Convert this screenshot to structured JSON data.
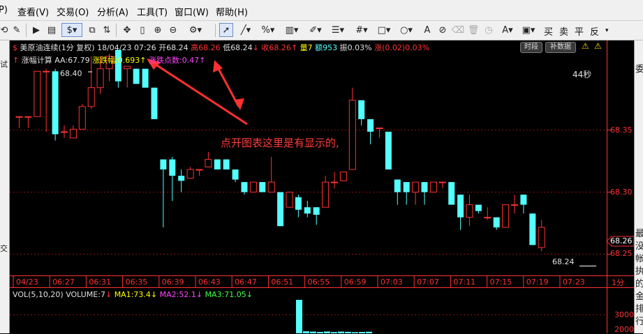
{
  "menu": {
    "items": [
      "P)",
      "查看(V)",
      "交易(O)",
      "分析(A)",
      "工具(T)",
      "窗口(W)",
      "帮助(H)"
    ]
  },
  "toolbar": {
    "text_buttons": [
      "买",
      "卖",
      "平",
      "反"
    ],
    "icons": [
      "rotate-icon",
      "edit-icon",
      "play-icon",
      "note-icon",
      "dollar-icon",
      "copy-icon",
      "sync-icon",
      "move-icon",
      "ruler-icon",
      "zoom-in-icon",
      "zoom-out-icon",
      "settings-icon",
      "cursor-icon",
      "line-icon",
      "percent-icon",
      "ruler-bar-icon",
      "pen-icon",
      "bars-icon",
      "grid-icon",
      "rect-icon",
      "circle-icon",
      "text-icon",
      "clear-icon",
      "trash-icon",
      "color-a-icon",
      "image-icon",
      "save-icon"
    ]
  },
  "left_strip": {
    "labels": [
      "试",
      "交"
    ]
  },
  "right_strip": {
    "labels": [
      "委",
      "最",
      "没",
      "帐",
      "执",
      "的",
      "金",
      "排",
      "行"
    ]
  },
  "header": {
    "symbol": "美原油连续(1分 复权)",
    "datetime": "18/04/23 07:26",
    "open_label": "开",
    "open": "68.24",
    "high_label": "高",
    "high": "68.26",
    "low_label": "低",
    "low": "68.24",
    "close_label": "收",
    "close": "68.26",
    "volume_label": "量",
    "volume": "7",
    "amount_label": "额",
    "amount": "953",
    "amplitude_label": "振",
    "amplitude": "0.03%",
    "change_label": "涨",
    "change": "(0.02)",
    "change_pct": "0.03%",
    "btn_time": "时段",
    "btn_fill": "补数据"
  },
  "indicator": {
    "name": "涨幅计算",
    "aa": "AA:67.79",
    "amp_label": "涨跌幅:",
    "amp_value": "0.693",
    "pts_label": "涨跌点数:",
    "pts_value": "0.47"
  },
  "countdown": "44秒",
  "high_marker": "68.40",
  "low_marker": "68.24",
  "annotation": "点开图表这里是有显示的,",
  "price_axis": {
    "ticks": [
      "68.35",
      "68.30",
      "68.25"
    ],
    "current": "68.26"
  },
  "time_axis": {
    "labels": [
      "04/23",
      "06:27",
      "06:31",
      "06:35",
      "06:39",
      "06:43",
      "06:47",
      "06:51",
      "06:55",
      "06:59",
      "07:03",
      "07:07",
      "07:11",
      "07:15",
      "07:19",
      "07:23"
    ],
    "period": "1分"
  },
  "volume_panel": {
    "title": "VOL(5,10,20)",
    "volume": "VOLUME:7",
    "ma1": "MA1:73.4",
    "ma2": "MA2:52.1",
    "ma3": "MA3:71.05",
    "ticks": [
      "3000",
      "2000"
    ]
  },
  "colors": {
    "up": "#ff3232",
    "down": "#54ffff",
    "ma1": "#ffff00",
    "ma2": "#ff00ff",
    "ma3": "#00ff00",
    "annotation": "#ff3c3c",
    "axis": "#ff3232"
  },
  "chart_data": {
    "type": "candlestick",
    "y_range": [
      68.2275,
      68.4125
    ],
    "candles": [
      {
        "o": 68.352,
        "h": 68.352,
        "l": 68.343,
        "c": 68.352
      },
      {
        "o": 68.352,
        "h": 68.352,
        "l": 68.343,
        "c": 68.352
      },
      {
        "o": 68.352,
        "h": 68.388,
        "l": 68.352,
        "c": 68.388
      },
      {
        "o": 68.388,
        "h": 68.39,
        "l": 68.34,
        "c": 68.388
      },
      {
        "o": 68.388,
        "h": 68.39,
        "l": 68.333,
        "c": 68.338
      },
      {
        "o": 68.34,
        "h": 68.345,
        "l": 68.335,
        "c": 68.34
      },
      {
        "o": 68.335,
        "h": 68.345,
        "l": 68.335,
        "c": 68.342
      },
      {
        "o": 68.342,
        "h": 68.362,
        "l": 68.342,
        "c": 68.36
      },
      {
        "o": 68.36,
        "h": 68.4,
        "l": 68.358,
        "c": 68.375
      },
      {
        "o": 68.375,
        "h": 68.4,
        "l": 68.37,
        "c": 68.39
      },
      {
        "o": 68.39,
        "h": 68.402,
        "l": 68.38,
        "c": 68.4
      },
      {
        "o": 68.405,
        "h": 68.405,
        "l": 68.375,
        "c": 68.38
      },
      {
        "o": 68.39,
        "h": 68.392,
        "l": 68.375,
        "c": 68.392
      },
      {
        "o": 68.39,
        "h": 68.39,
        "l": 68.378,
        "c": 68.378
      },
      {
        "o": 68.39,
        "h": 68.39,
        "l": 68.375,
        "c": 68.375
      },
      {
        "o": 68.375,
        "h": 68.375,
        "l": 68.35,
        "c": 68.35
      },
      {
        "o": 68.318,
        "h": 68.318,
        "l": 68.264,
        "c": 68.31
      },
      {
        "o": 68.318,
        "h": 68.32,
        "l": 68.285,
        "c": 68.305
      },
      {
        "o": 68.305,
        "h": 68.31,
        "l": 68.292,
        "c": 68.301
      },
      {
        "o": 68.303,
        "h": 68.312,
        "l": 68.303,
        "c": 68.31
      },
      {
        "o": 68.31,
        "h": 68.31,
        "l": 68.305,
        "c": 68.31
      },
      {
        "o": 68.312,
        "h": 68.324,
        "l": 68.312,
        "c": 68.318
      },
      {
        "o": 68.318,
        "h": 68.318,
        "l": 68.31,
        "c": 68.31
      },
      {
        "o": 68.318,
        "h": 68.318,
        "l": 68.31,
        "c": 68.31
      },
      {
        "o": 68.31,
        "h": 68.31,
        "l": 68.3,
        "c": 68.302
      },
      {
        "o": 68.3,
        "h": 68.3,
        "l": 68.29,
        "c": 68.292
      },
      {
        "o": 68.292,
        "h": 68.3,
        "l": 68.292,
        "c": 68.3
      },
      {
        "o": 68.3,
        "h": 68.3,
        "l": 68.292,
        "c": 68.292
      },
      {
        "o": 68.292,
        "h": 68.32,
        "l": 68.292,
        "c": 68.3
      },
      {
        "o": 68.292,
        "h": 68.292,
        "l": 68.265,
        "c": 68.265
      },
      {
        "o": 68.28,
        "h": 68.292,
        "l": 68.28,
        "c": 68.292
      },
      {
        "o": 68.288,
        "h": 68.29,
        "l": 68.272,
        "c": 68.278
      },
      {
        "o": 68.28,
        "h": 68.285,
        "l": 68.272,
        "c": 68.275
      },
      {
        "o": 68.28,
        "h": 68.28,
        "l": 68.266,
        "c": 68.274
      },
      {
        "o": 68.28,
        "h": 68.305,
        "l": 68.28,
        "c": 68.3
      },
      {
        "o": 68.3,
        "h": 68.308,
        "l": 68.295,
        "c": 68.3
      },
      {
        "o": 68.301,
        "h": 68.308,
        "l": 68.301,
        "c": 68.308
      },
      {
        "o": 68.31,
        "h": 68.375,
        "l": 68.31,
        "c": 68.365
      },
      {
        "o": 68.365,
        "h": 68.365,
        "l": 68.345,
        "c": 68.35
      },
      {
        "o": 68.35,
        "h": 68.35,
        "l": 68.33,
        "c": 68.34
      },
      {
        "o": 68.343,
        "h": 68.343,
        "l": 68.335,
        "c": 68.343
      },
      {
        "o": 68.34,
        "h": 68.34,
        "l": 68.31,
        "c": 68.31
      },
      {
        "o": 68.302,
        "h": 68.302,
        "l": 68.282,
        "c": 68.292
      },
      {
        "o": 68.3,
        "h": 68.3,
        "l": 68.282,
        "c": 68.292
      },
      {
        "o": 68.292,
        "h": 68.3,
        "l": 68.282,
        "c": 68.3
      },
      {
        "o": 68.3,
        "h": 68.3,
        "l": 68.282,
        "c": 68.292
      },
      {
        "o": 68.292,
        "h": 68.3,
        "l": 68.292,
        "c": 68.3
      },
      {
        "o": 68.3,
        "h": 68.3,
        "l": 68.295,
        "c": 68.3
      },
      {
        "o": 68.3,
        "h": 68.3,
        "l": 68.282,
        "c": 68.282
      },
      {
        "o": 68.29,
        "h": 68.29,
        "l": 68.262,
        "c": 68.272
      },
      {
        "o": 68.272,
        "h": 68.29,
        "l": 68.265,
        "c": 68.282
      },
      {
        "o": 68.282,
        "h": 68.282,
        "l": 68.275,
        "c": 68.277
      },
      {
        "o": 68.272,
        "h": 68.28,
        "l": 68.27,
        "c": 68.272
      },
      {
        "o": 68.272,
        "h": 68.272,
        "l": 68.262,
        "c": 68.264
      },
      {
        "o": 68.264,
        "h": 68.282,
        "l": 68.264,
        "c": 68.282
      },
      {
        "o": 68.282,
        "h": 68.29,
        "l": 68.275,
        "c": 68.282
      },
      {
        "o": 68.29,
        "h": 68.29,
        "l": 68.275,
        "c": 68.282
      },
      {
        "o": 68.275,
        "h": 68.275,
        "l": 68.25,
        "c": 68.25
      },
      {
        "o": 68.248,
        "h": 68.27,
        "l": 68.245,
        "c": 68.264
      }
    ],
    "volume": [
      3900,
      180,
      150,
      120,
      160,
      110,
      150,
      130,
      100,
      120,
      140
    ]
  }
}
